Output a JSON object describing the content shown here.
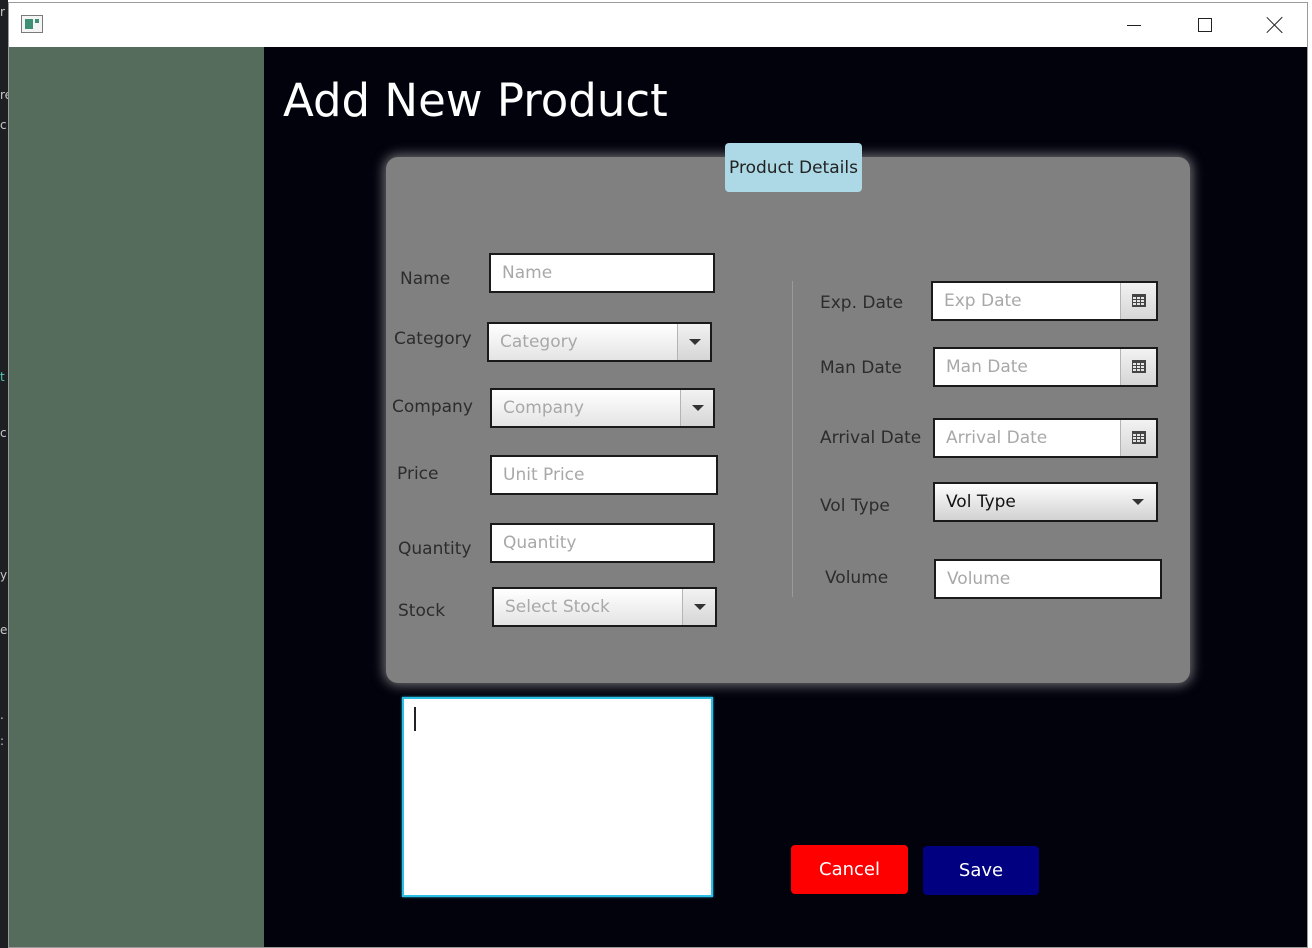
{
  "window": {
    "app_icon": "app-window-icon",
    "controls": {
      "minimize": "minimize-icon",
      "maximize": "maximize-icon",
      "close": "close-icon"
    }
  },
  "background_glyphs": [
    "r",
    "re",
    "c",
    "t",
    "c",
    "y",
    "e",
    ".",
    ":"
  ],
  "colors": {
    "sidebar": "#556b5b",
    "main_background": "#02020c",
    "panel": "#808080",
    "panel_tab": "#add8e6",
    "cancel": "#ff0000",
    "save": "#000080",
    "focus_border": "#2cc0e6"
  },
  "page": {
    "title": "Add New Product"
  },
  "panel": {
    "tab_label": "Product Details"
  },
  "form_left": {
    "name": {
      "label": "Name",
      "placeholder": "Name"
    },
    "category": {
      "label": "Category",
      "placeholder": "Category"
    },
    "company": {
      "label": "Company",
      "placeholder": "Company"
    },
    "price": {
      "label": "Price",
      "placeholder": "Unit Price"
    },
    "quantity": {
      "label": "Quantity",
      "placeholder": "Quantity"
    },
    "stock": {
      "label": "Stock",
      "placeholder": "Select Stock"
    }
  },
  "form_right": {
    "exp_date": {
      "label": "Exp. Date",
      "placeholder": "Exp Date"
    },
    "man_date": {
      "label": "Man Date",
      "placeholder": "Man Date"
    },
    "arrival_date": {
      "label": "Arrival Date",
      "placeholder": "Arrival Date"
    },
    "vol_type": {
      "label": "Vol Type",
      "value": "Vol Type"
    },
    "volume": {
      "label": "Volume",
      "placeholder": "Volume"
    }
  },
  "notes": {
    "value": ""
  },
  "actions": {
    "cancel_label": "Cancel",
    "save_label": "Save"
  }
}
